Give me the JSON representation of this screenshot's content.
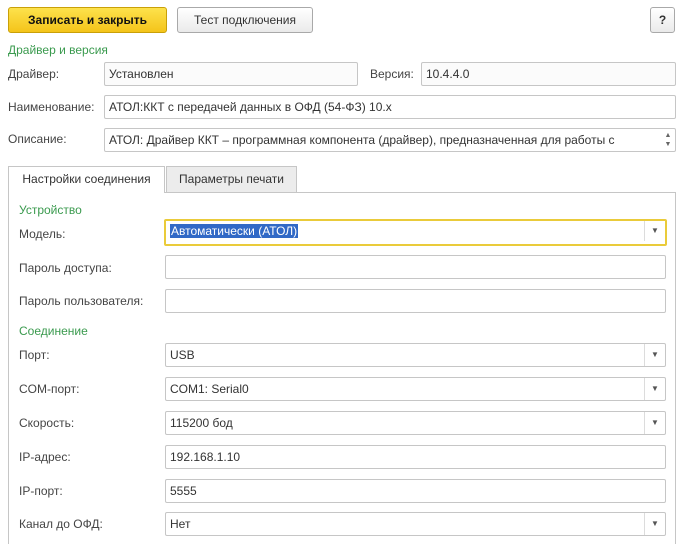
{
  "toolbar": {
    "save_close_label": "Записать и закрыть",
    "test_label": "Тест подключения",
    "help_label": "?"
  },
  "driver_section": {
    "title": "Драйвер и версия",
    "driver_label": "Драйвер:",
    "driver_value": "Установлен",
    "version_label": "Версия:",
    "version_value": "10.4.4.0",
    "name_label": "Наименование:",
    "name_value": "АТОЛ:ККТ с передачей данных в ОФД (54-ФЗ) 10.х",
    "description_label": "Описание:",
    "description_value": "АТОЛ: Драйвер ККТ – программная компонента (драйвер), предназначенная для работы с"
  },
  "tabs": [
    {
      "label": "Настройки соединения",
      "active": true
    },
    {
      "label": "Параметры печати",
      "active": false
    }
  ],
  "device_section": {
    "title": "Устройство",
    "model_label": "Модель:",
    "model_value": "Автоматически (АТОЛ)",
    "access_password_label": "Пароль доступа:",
    "access_password_value": "",
    "user_password_label": "Пароль пользователя:",
    "user_password_value": ""
  },
  "connection_section": {
    "title": "Соединение",
    "port_label": "Порт:",
    "port_value": "USB",
    "com_port_label": "COM-порт:",
    "com_port_value": "COM1: Serial0",
    "speed_label": "Скорость:",
    "speed_value": "115200 бод",
    "ip_label": "IP-адрес:",
    "ip_value": "192.168.1.10",
    "ip_port_label": "IP-порт:",
    "ip_port_value": "5555",
    "ofd_channel_label": "Канал до ОФД:",
    "ofd_channel_value": "Нет"
  },
  "colors": {
    "primary_button": "#f4c41a",
    "section_title": "#3a9a4e",
    "focus_border": "#eacb3a",
    "selection": "#3169c6"
  },
  "icons": {
    "dropdown": "triangle-down",
    "spinner": "up-down-arrows"
  }
}
